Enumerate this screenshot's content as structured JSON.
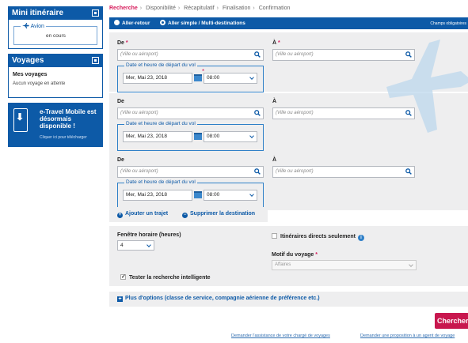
{
  "sidebar": {
    "mini": {
      "title": "Mini itinéraire",
      "flight_label": "Avion",
      "flight_state": "en cours"
    },
    "voyages": {
      "title": "Voyages",
      "heading": "Mes voyages",
      "empty_text": "Aucun voyage en attente"
    },
    "promo": {
      "title": "e-Travel Mobile est désormais disponible !",
      "subtitle": "Cliquer ici pour télécharger"
    }
  },
  "breadcrumb": {
    "steps": [
      "Recherche",
      "Disponibilité",
      "Récapitulatif",
      "Finalisation",
      "Confirmation"
    ],
    "active_index": 0
  },
  "trip_type": {
    "options": [
      "Aller-retour",
      "Aller simple / Multi-destinations"
    ],
    "selected_index": 1,
    "required_note": "Champs obligatoires"
  },
  "segments": [
    {
      "from_label": "De",
      "to_label": "À",
      "from_placeholder": "(Ville ou aéroport)",
      "to_placeholder": "(Ville ou aéroport)",
      "date_legend": "Date et heure de départ du vol",
      "date": "Mer, Mai 23, 2018",
      "time": "08:00",
      "required": true
    },
    {
      "from_label": "De",
      "to_label": "À",
      "from_placeholder": "(Ville ou aéroport)",
      "to_placeholder": "(Ville ou aéroport)",
      "date_legend": "Date et heure de départ du vol",
      "date": "Mer, Mai 23, 2018",
      "time": "08:00",
      "required": false
    },
    {
      "from_label": "De",
      "to_label": "À",
      "from_placeholder": "(Ville ou aéroport)",
      "to_placeholder": "(Ville ou aéroport)",
      "date_legend": "Date et heure de départ du vol",
      "date": "Mer, Mai 23, 2018",
      "time": "08:00",
      "required": false
    }
  ],
  "actions": {
    "add_trip": "Ajouter un trajet",
    "remove_destination": "Supprimer la destination"
  },
  "options": {
    "window_label": "Fenêtre horaire (heures)",
    "window_value": "4",
    "direct_label": "Itinéraires directs seulement",
    "direct_checked": false,
    "motif_label": "Motif du voyage",
    "motif_value": "Affaires",
    "smart_label": "Tester la recherche intelligente",
    "smart_checked": true
  },
  "more_options": "Plus d'options (classe de service, compagnie aérienne de préférence etc.)",
  "search_button": "Chercher",
  "footer": {
    "assist_link": "Demander l'assistance de votre chargé de voyages",
    "proposal_link": "Demander une proposition à un agent de voyage"
  },
  "colors": {
    "brand": "#0d5aa7",
    "accent": "#c8174e",
    "panel_bg": "#eeeeef"
  }
}
